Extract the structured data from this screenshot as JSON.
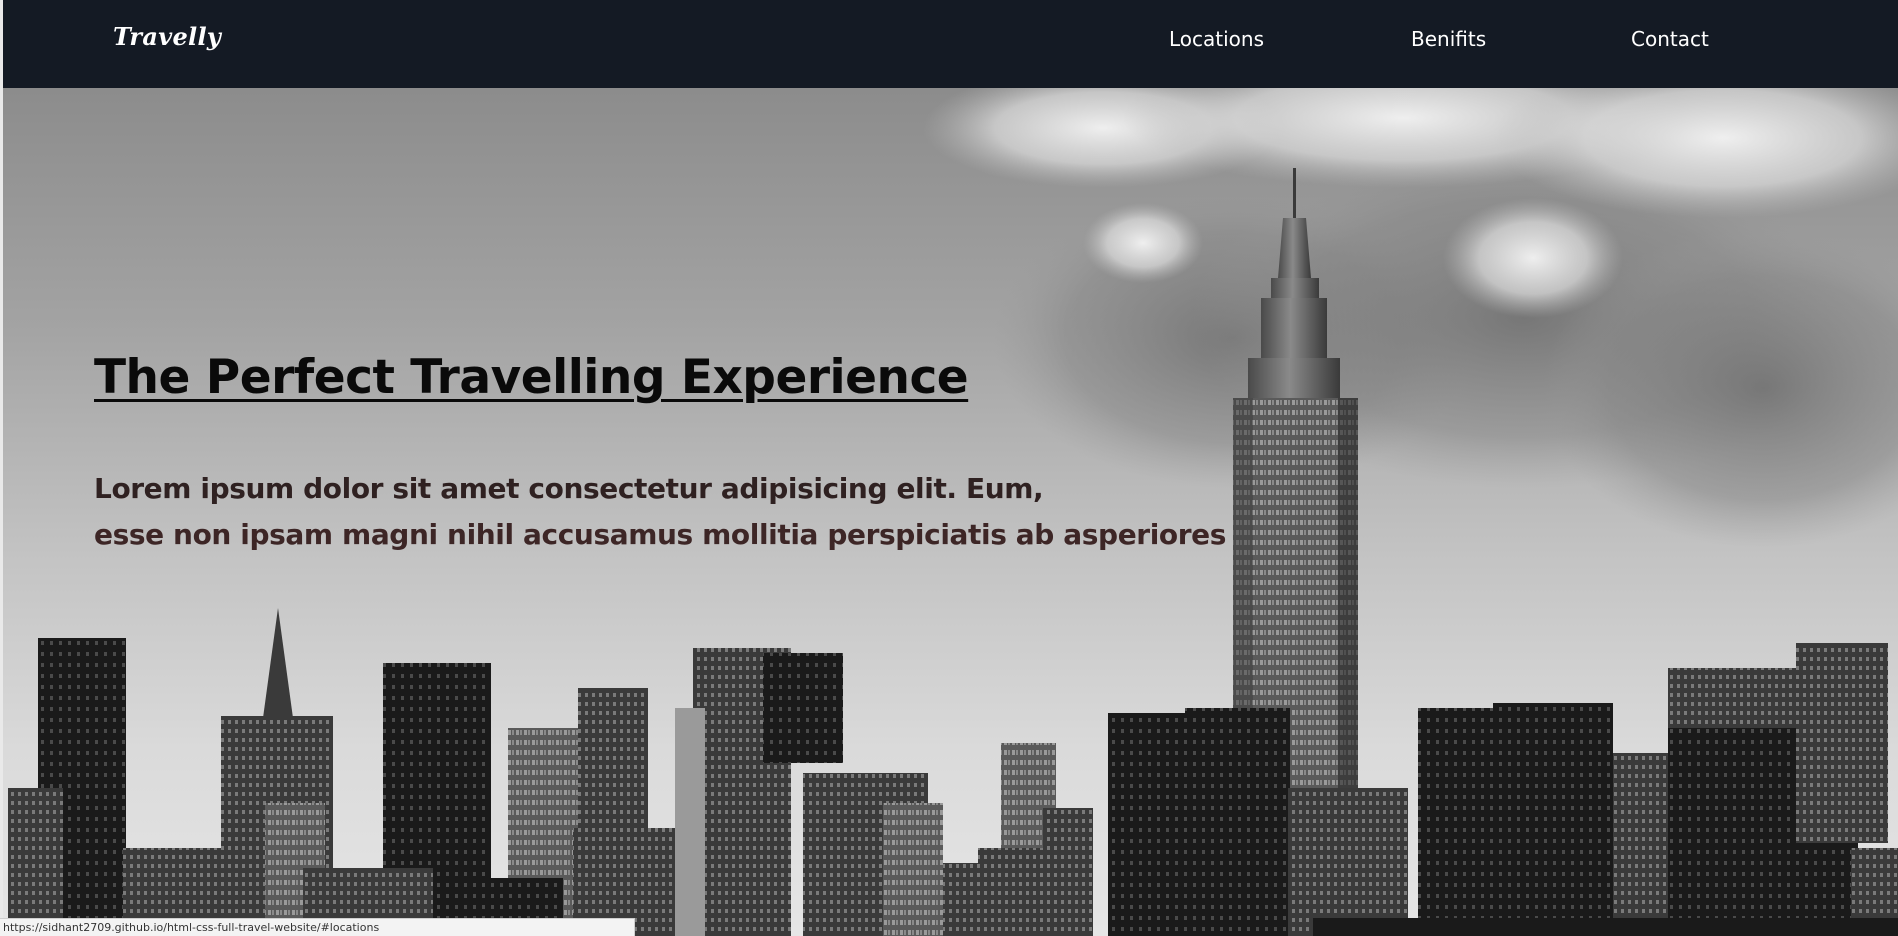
{
  "navbar": {
    "logo": "Travelly",
    "links": [
      "Locations",
      "Benifits",
      "Contact"
    ],
    "background": "#141a24"
  },
  "hero": {
    "title": "The Perfect Travelling Experience",
    "text_line_1": "Lorem ipsum dolor sit amet consectetur adipisicing elit. Eum,",
    "text_line_2": "esse non ipsam magni nihil accusamus mollitia perspiciatis ab asperiores",
    "background_image": "grayscale city skyline with tall skyscraper and clouds"
  },
  "statusbar": {
    "url": "https://sidhant2709.github.io/html-css-full-travel-website/#locations"
  }
}
